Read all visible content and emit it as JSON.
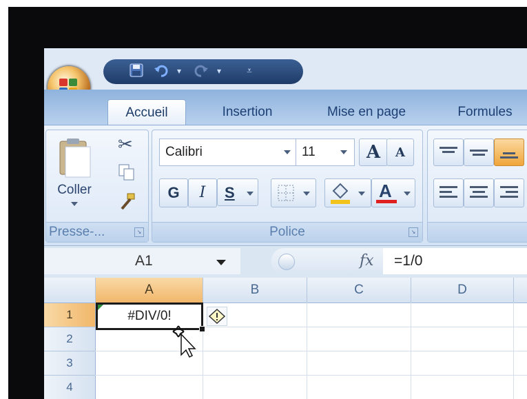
{
  "title_bar": {
    "quick_access": [
      "save-icon",
      "undo-icon",
      "redo-icon",
      "customize-icon"
    ]
  },
  "tabs": [
    {
      "label": "Accueil",
      "active": true
    },
    {
      "label": "Insertion",
      "active": false
    },
    {
      "label": "Mise en page",
      "active": false
    },
    {
      "label": "Formules",
      "active": false
    }
  ],
  "ribbon": {
    "clipboard": {
      "paste_label": "Coller",
      "group_label": "Presse-..."
    },
    "font": {
      "font_name": "Calibri",
      "font_size": "11",
      "grow_label": "A",
      "shrink_label": "A",
      "bold_label": "G",
      "italic_label": "I",
      "underline_label": "S",
      "font_color_label": "A",
      "group_label": "Police"
    }
  },
  "formula_bar": {
    "name_box": "A1",
    "fx_label": "fx",
    "formula": "=1/0"
  },
  "grid": {
    "columns": [
      "A",
      "B",
      "C",
      "D"
    ],
    "rows": [
      "1",
      "2",
      "3",
      "4"
    ],
    "cell_A1": "#DIV/0!"
  },
  "colors": {
    "accent_orange": "#f1b76a",
    "ribbon_blue": "#b9d1ee"
  }
}
